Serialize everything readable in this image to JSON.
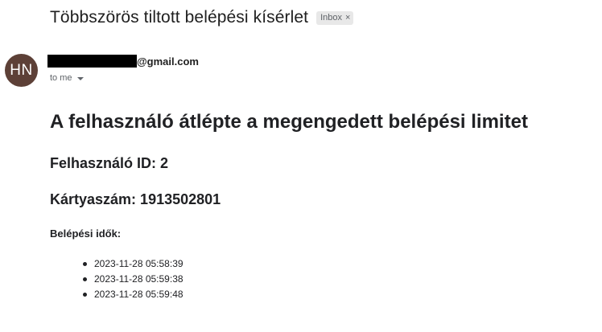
{
  "email": {
    "subject": "Többszörös tiltott belépési kísérlet",
    "label_badge": "Inbox",
    "label_badge_close": "×",
    "sender": {
      "avatar_initials": "HN",
      "avatar_color": "#5d4037",
      "address_domain": "@gmail.com"
    },
    "recipient_line": "to me"
  },
  "message": {
    "heading": "A felhasználó átlépte a megengedett belépési limitet",
    "user_id_line": "Felhasználó ID: 2",
    "card_number_line": "Kártyaszám: 1913502801",
    "login_times_label": "Belépési idők:",
    "login_times": [
      "2023-11-28 05:58:39",
      "2023-11-28 05:59:38",
      "2023-11-28 05:59:48"
    ]
  }
}
